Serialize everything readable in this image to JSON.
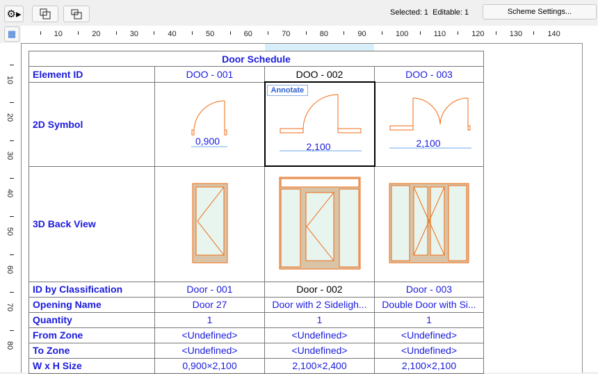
{
  "toolbar": {
    "selected": "Selected: 1",
    "editable": "Editable: 1",
    "scheme_button": "Scheme Settings..."
  },
  "ruler": {
    "top": [
      "10",
      "20",
      "30",
      "40",
      "50",
      "60",
      "70",
      "80",
      "90",
      "100",
      "110",
      "120",
      "130",
      "140"
    ],
    "left": [
      "10",
      "20",
      "30",
      "40",
      "50",
      "60",
      "70",
      "80"
    ]
  },
  "schedule": {
    "title": "Door Schedule",
    "annotate_label": "Annotate",
    "row_headers": [
      "Element ID",
      "2D Symbol",
      "3D Back View",
      "ID by Classification",
      "Opening Name",
      "Quantity",
      "From Zone",
      "To Zone",
      "W x H Size"
    ],
    "columns": [
      {
        "element_id": "DOO - 001",
        "dim": "0,900",
        "classification": "Door - 001",
        "opening_name": "Door 27",
        "quantity": "1",
        "from_zone": "<Undefined>",
        "to_zone": "<Undefined>",
        "size": "0,900×2,100"
      },
      {
        "element_id": "DOO - 002",
        "dim": "2,100",
        "classification": "Door - 002",
        "opening_name": "Door with 2 Sideligh...",
        "quantity": "1",
        "from_zone": "<Undefined>",
        "to_zone": "<Undefined>",
        "size": "2,100×2,400"
      },
      {
        "element_id": "DOO - 003",
        "dim": "2,100",
        "classification": "Door - 003",
        "opening_name": "Double Door with Si...",
        "quantity": "1",
        "from_zone": "<Undefined>",
        "to_zone": "<Undefined>",
        "size": "2,100×2,100"
      }
    ]
  },
  "colors": {
    "accent": "#1a1adc",
    "door": "#f06a10"
  }
}
